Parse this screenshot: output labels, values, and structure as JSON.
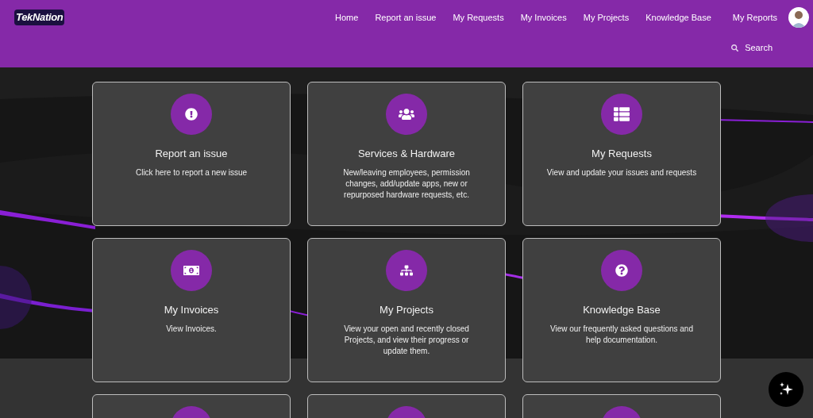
{
  "header": {
    "logo": "TekNation",
    "nav": [
      {
        "label": "Home"
      },
      {
        "label": "Report an issue"
      },
      {
        "label": "My Requests"
      },
      {
        "label": "My Invoices"
      },
      {
        "label": "My Projects"
      },
      {
        "label": "Knowledge Base"
      },
      {
        "label": "My Reports"
      }
    ],
    "search": "Search"
  },
  "cards": [
    {
      "kind": "full",
      "title": "Report an issue",
      "description": "Click here to report a new issue"
    },
    {
      "kind": "full",
      "title": "Services & Hardware",
      "description": "New/leaving employees, permission changes, add/update apps, new or repurposed hardware requests, etc."
    },
    {
      "kind": "full",
      "title": "My Requests",
      "description": "View and update your issues and requests"
    },
    {
      "kind": "full",
      "title": "My Invoices",
      "description": "View Invoices."
    },
    {
      "kind": "full",
      "title": "My Projects",
      "description": "View your open and recently closed Projects, and view their progress or update them."
    },
    {
      "kind": "full",
      "title": "Knowledge Base",
      "description": "View our frequently asked questions and help documentation."
    },
    {
      "kind": "partial"
    },
    {
      "kind": "partial"
    },
    {
      "kind": "partial"
    }
  ]
}
